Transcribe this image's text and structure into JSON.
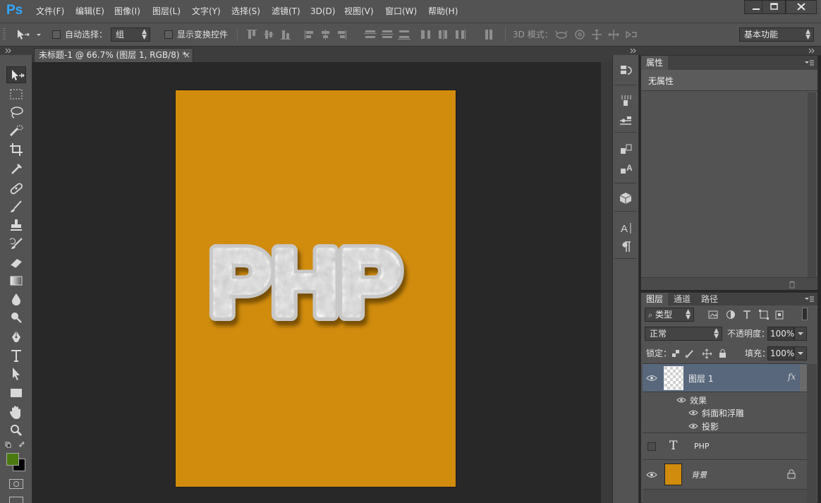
{
  "app": {
    "logo": "Ps"
  },
  "menu": [
    {
      "id": "file",
      "label": "文件(F)"
    },
    {
      "id": "edit",
      "label": "编辑(E)"
    },
    {
      "id": "image",
      "label": "图像(I)"
    },
    {
      "id": "layer",
      "label": "图层(L)"
    },
    {
      "id": "type",
      "label": "文字(Y)"
    },
    {
      "id": "select",
      "label": "选择(S)"
    },
    {
      "id": "filter",
      "label": "滤镜(T)"
    },
    {
      "id": "3d",
      "label": "3D(D)"
    },
    {
      "id": "view",
      "label": "视图(V)"
    },
    {
      "id": "window",
      "label": "窗口(W)"
    },
    {
      "id": "help",
      "label": "帮助(H)"
    }
  ],
  "options": {
    "auto_select_label": "自动选择：",
    "auto_select_value": "组",
    "show_transform_label": "显示变换控件",
    "mode_3d_label": "3D 模式：",
    "workspace": "基本功能"
  },
  "document": {
    "tab_title": "未标题-1 @ 66.7% (图层 1, RGB/8) *",
    "close_glyph": "×",
    "canvas_color": "#d18c0e",
    "art_text": "PHP"
  },
  "properties": {
    "tab": "属性",
    "content": "无属性"
  },
  "layers": {
    "tabs": [
      "图层",
      "通道",
      "路径"
    ],
    "filter_kind": "类型",
    "blend_mode": "正常",
    "opacity_label": "不透明度：",
    "opacity_value": "100%",
    "lock_label": "锁定：",
    "fill_label": "填充：",
    "fill_value": "100%",
    "items": [
      {
        "name": "图层 1",
        "fx": "fx",
        "effects_label": "效果",
        "effects": [
          "斜面和浮雕",
          "投影"
        ]
      },
      {
        "name": "PHP",
        "type_glyph": "T"
      },
      {
        "name": "背景"
      }
    ]
  },
  "colors": {
    "foreground": "#4a7a10",
    "background": "#000000",
    "selected_layer": "#58677c"
  }
}
